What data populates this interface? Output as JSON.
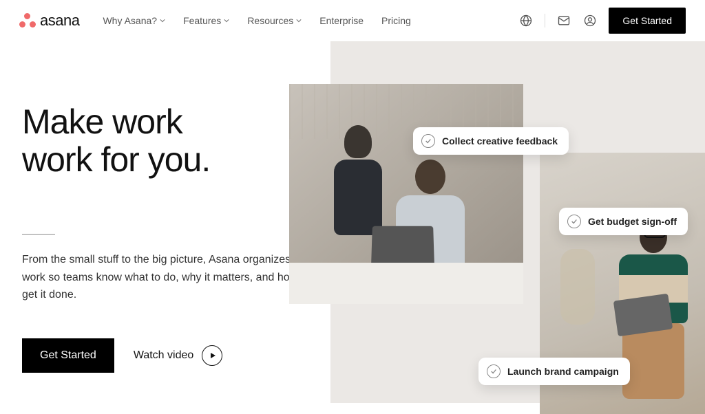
{
  "brand": {
    "name": "asana"
  },
  "nav": {
    "items": [
      {
        "label": "Why Asana?",
        "has_dropdown": true
      },
      {
        "label": "Features",
        "has_dropdown": true
      },
      {
        "label": "Resources",
        "has_dropdown": true
      },
      {
        "label": "Enterprise",
        "has_dropdown": false
      },
      {
        "label": "Pricing",
        "has_dropdown": false
      }
    ]
  },
  "header_cta": "Get Started",
  "hero": {
    "headline_line1": "Make work",
    "headline_line2": "work for you.",
    "subtext": "From the small stuff to the big picture, Asana organizes work so teams know what to do, why it matters, and how to get it done.",
    "cta_primary": "Get Started",
    "cta_secondary": "Watch video"
  },
  "chips": [
    "Collect creative feedback",
    "Get budget sign-off",
    "Launch brand campaign"
  ],
  "icons": {
    "globe": "globe-icon",
    "mail": "mail-icon",
    "user": "user-icon"
  },
  "colors": {
    "brand_coral": "#f06a6a",
    "black": "#000000",
    "bg_gray": "#ebe8e5"
  }
}
